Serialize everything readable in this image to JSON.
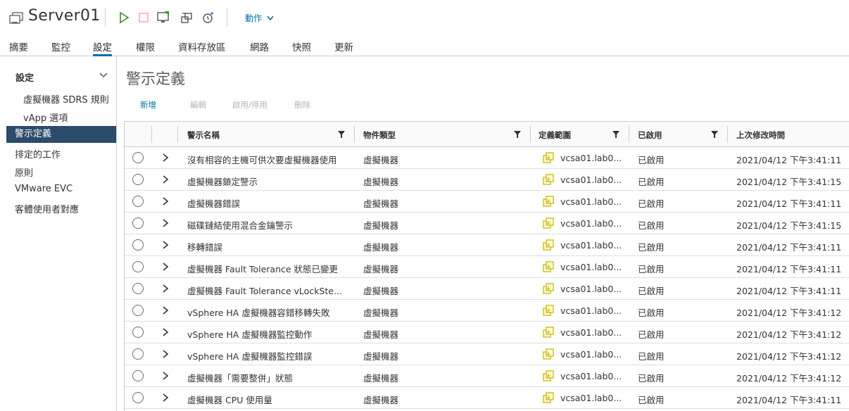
{
  "header": {
    "title": "Server01",
    "actions_label": "動作"
  },
  "tabs": [
    {
      "label": "摘要"
    },
    {
      "label": "監控"
    },
    {
      "label": "設定"
    },
    {
      "label": "權限"
    },
    {
      "label": "資料存放區"
    },
    {
      "label": "網路"
    },
    {
      "label": "快照"
    },
    {
      "label": "更新"
    }
  ],
  "active_tab": "設定",
  "sidebar": {
    "section_title": "設定",
    "items": [
      {
        "label": "虛擬機器 SDRS 規則"
      },
      {
        "label": "vApp 選項"
      },
      {
        "label": "警示定義"
      },
      {
        "label": "排定的工作"
      },
      {
        "label": "原則"
      },
      {
        "label": "VMware EVC"
      },
      {
        "label": "客體使用者對應"
      }
    ],
    "active_item": "警示定義"
  },
  "main": {
    "title": "警示定義",
    "toolbar": {
      "add": "新增",
      "edit": "編輯",
      "enable_disable": "啟用/停用",
      "delete": "刪除"
    },
    "columns": {
      "name": "警示名稱",
      "object_type": "物件類型",
      "defined_in": "定義範圍",
      "enabled": "已啟用",
      "last_modified": "上次修改時間"
    },
    "rows": [
      {
        "name": "沒有相容的主機可供次要虛擬機器使用",
        "type": "虛擬機器",
        "scope": "vcsa01.lab0...",
        "enabled": "已啟用",
        "time": "2021/04/12 下午3:41:11"
      },
      {
        "name": "虛擬機器鎖定警示",
        "type": "虛擬機器",
        "scope": "vcsa01.lab0...",
        "enabled": "已啟用",
        "time": "2021/04/12 下午3:41:15"
      },
      {
        "name": "虛擬機器錯誤",
        "type": "虛擬機器",
        "scope": "vcsa01.lab0...",
        "enabled": "已啟用",
        "time": "2021/04/12 下午3:41:11"
      },
      {
        "name": "磁碟鏈結使用混合金鑰警示",
        "type": "虛擬機器",
        "scope": "vcsa01.lab0...",
        "enabled": "已啟用",
        "time": "2021/04/12 下午3:41:15"
      },
      {
        "name": "移轉錯誤",
        "type": "虛擬機器",
        "scope": "vcsa01.lab0...",
        "enabled": "已啟用",
        "time": "2021/04/12 下午3:41:11"
      },
      {
        "name": "虛擬機器 Fault Tolerance 狀態已變更",
        "type": "虛擬機器",
        "scope": "vcsa01.lab0...",
        "enabled": "已啟用",
        "time": "2021/04/12 下午3:41:11"
      },
      {
        "name": "虛擬機器 Fault Tolerance vLockSte...",
        "type": "虛擬機器",
        "scope": "vcsa01.lab0...",
        "enabled": "已啟用",
        "time": "2021/04/12 下午3:41:11"
      },
      {
        "name": "vSphere HA 虛擬機器容錯移轉失敗",
        "type": "虛擬機器",
        "scope": "vcsa01.lab0...",
        "enabled": "已啟用",
        "time": "2021/04/12 下午3:41:12"
      },
      {
        "name": "vSphere HA 虛擬機器監控動作",
        "type": "虛擬機器",
        "scope": "vcsa01.lab0...",
        "enabled": "已啟用",
        "time": "2021/04/12 下午3:41:12"
      },
      {
        "name": "vSphere HA 虛擬機器監控錯誤",
        "type": "虛擬機器",
        "scope": "vcsa01.lab0...",
        "enabled": "已啟用",
        "time": "2021/04/12 下午3:41:12"
      },
      {
        "name": "虛擬機器「需要整併」狀態",
        "type": "虛擬機器",
        "scope": "vcsa01.lab0...",
        "enabled": "已啟用",
        "time": "2021/04/12 下午3:41:12"
      },
      {
        "name": "虛擬機器 CPU 使用量",
        "type": "虛擬機器",
        "scope": "vcsa01.lab0...",
        "enabled": "已啟用",
        "time": "2021/04/12 下午3:41:11"
      }
    ]
  },
  "colors": {
    "accent": "#0072a3",
    "sidebar_active_bg": "#2d4b6a",
    "power_on": "#3c8a2e",
    "power_off": "#e57373",
    "scope_icon": "#c9b800"
  },
  "icons": {
    "vm": "vm-icon",
    "power_on": "power-on-icon",
    "power_off": "power-off-icon",
    "console": "console-icon",
    "migrate": "migrate-icon",
    "snapshot": "snapshot-icon",
    "filter": "filter-icon",
    "expand": "chevron-right-icon",
    "scope": "vcenter-icon"
  }
}
